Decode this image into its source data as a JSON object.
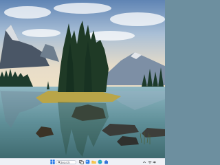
{
  "desktop": {
    "wallpaper_icon": "landscape-wallpaper"
  },
  "taskbar": {
    "search_label": "Search",
    "pinned": [
      {
        "name": "start-button",
        "icon": "windows-logo-icon",
        "color": "#1a73e8"
      },
      {
        "name": "widgets",
        "icon": "widgets-icon",
        "color": "#2b7de9"
      },
      {
        "name": "task-view",
        "icon": "task-view-icon",
        "color": "#3a3a3a"
      },
      {
        "name": "file-explorer",
        "icon": "folder-icon",
        "color": "#f2b233"
      },
      {
        "name": "browser",
        "icon": "browser-icon",
        "color": "#1f9bd8"
      },
      {
        "name": "store",
        "icon": "store-icon",
        "color": "#2f6fd6"
      }
    ],
    "tray": {
      "time": "",
      "date": ""
    }
  }
}
